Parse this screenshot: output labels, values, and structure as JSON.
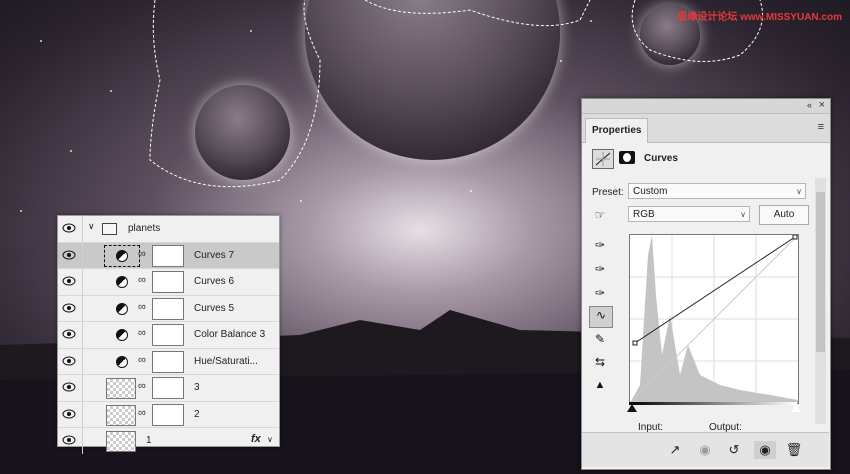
{
  "watermark": "思缘设计论坛 www.MISSYUAN.com",
  "layers": {
    "group_name": "planets",
    "rows": [
      {
        "name": "Curves 7",
        "type": "adjustment",
        "selected": true
      },
      {
        "name": "Curves 6",
        "type": "adjustment"
      },
      {
        "name": "Curves 5",
        "type": "adjustment"
      },
      {
        "name": "Color Balance 3",
        "type": "adjustment"
      },
      {
        "name": "Hue/Saturati...",
        "type": "adjustment"
      },
      {
        "name": "3",
        "type": "smart"
      },
      {
        "name": "2",
        "type": "smart"
      },
      {
        "name": "1",
        "type": "smart",
        "fx": "fx"
      }
    ]
  },
  "properties": {
    "tab": "Properties",
    "title": "Curves",
    "preset_label": "Preset:",
    "preset_value": "Custom",
    "channel": "RGB",
    "auto_button": "Auto",
    "input_label": "Input:",
    "output_label": "Output:"
  },
  "icons": [
    "eye-icon",
    "folder-icon",
    "link-icon",
    "curves-icon",
    "mask-icon",
    "eyedropper-icon",
    "pencil-icon",
    "clip-icon",
    "reset-icon",
    "visibility-icon",
    "trash-icon",
    "menu-icon",
    "collapse-icon",
    "close-icon"
  ],
  "colors": {
    "selected_row": "#c9c9c9",
    "panel_bg": "#f0f0f0",
    "watermark": "#e53a3a"
  }
}
